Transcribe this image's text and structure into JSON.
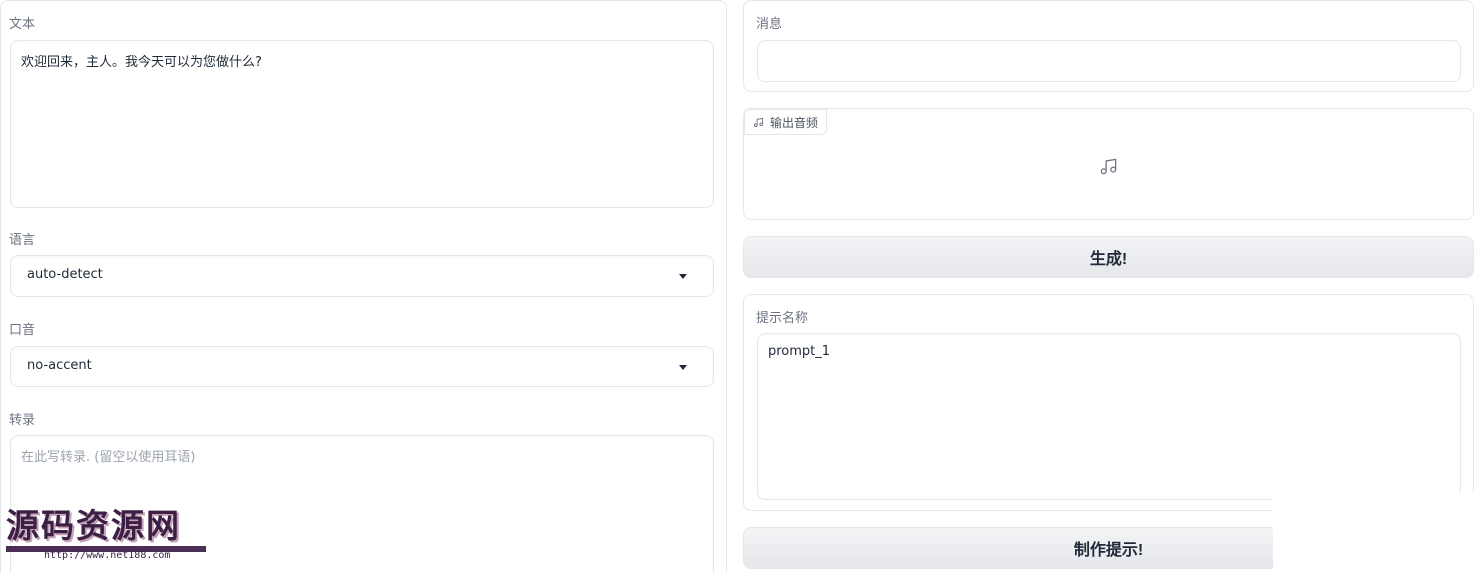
{
  "left": {
    "text": {
      "label": "文本",
      "value": "欢迎回来，主人。我今天可以为您做什么?"
    },
    "language": {
      "label": "语言",
      "value": "auto-detect"
    },
    "accent": {
      "label": "口音",
      "value": "no-accent"
    },
    "transcript": {
      "label": "转录",
      "placeholder": "在此写转录. (留空以使用耳语)"
    }
  },
  "right": {
    "message": {
      "label": "消息",
      "value": ""
    },
    "audio": {
      "label": "输出音频"
    },
    "generate_button": "生成!",
    "prompt_name": {
      "label": "提示名称",
      "value": "prompt_1"
    },
    "make_prompt_button": "制作提示!"
  },
  "watermark": {
    "text": "源码资源网",
    "url": "http://www.net188.com"
  },
  "icons": {
    "audio_tag": "music-note-icon",
    "audio_placeholder": "music-note-icon",
    "select_caret": "caret-down-icon"
  }
}
